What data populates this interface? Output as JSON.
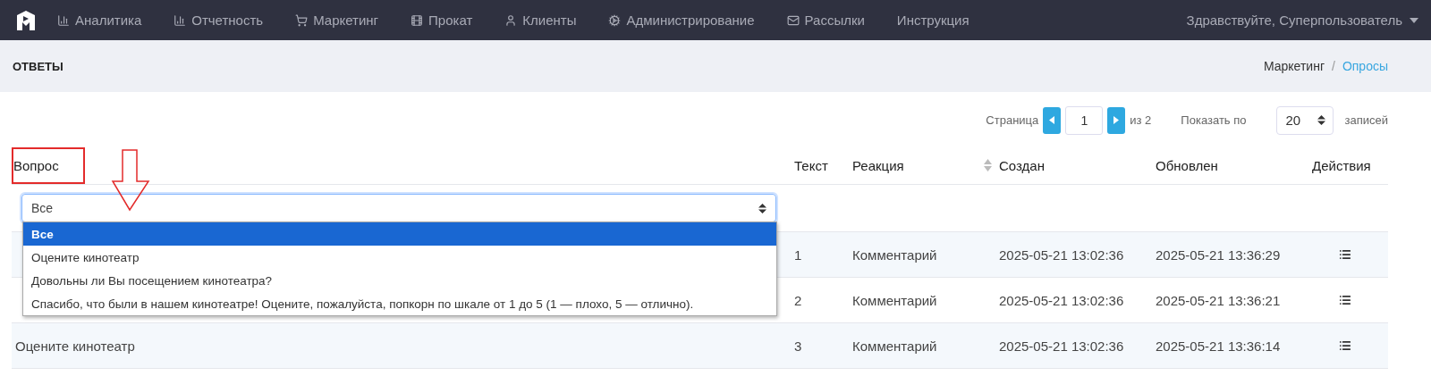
{
  "nav": {
    "items": [
      {
        "label": "Аналитика"
      },
      {
        "label": "Отчетность"
      },
      {
        "label": "Маркетинг"
      },
      {
        "label": "Прокат"
      },
      {
        "label": "Клиенты"
      },
      {
        "label": "Администрирование"
      },
      {
        "label": "Рассылки"
      },
      {
        "label": "Инструкция"
      }
    ],
    "user": "Здравствуйте, Суперпользователь"
  },
  "page_header": {
    "title": "ОТВЕТЫ",
    "separator": "/",
    "breadcrumb": [
      {
        "label": "Маркетинг",
        "kind": "text"
      },
      {
        "label": "Опросы",
        "kind": "link"
      }
    ]
  },
  "pagination": {
    "label": "Страница",
    "page": "1",
    "of": "из 2",
    "show_label": "Показать по",
    "per_page": "20",
    "suffix": "записей"
  },
  "table": {
    "columns": [
      {
        "label": "Вопрос",
        "sortable": false
      },
      {
        "label": "Текст",
        "sortable": false
      },
      {
        "label": "Реакция",
        "sortable": true
      },
      {
        "label": "Создан",
        "sortable": false
      },
      {
        "label": "Обновлен",
        "sortable": false
      },
      {
        "label": "Действия",
        "sortable": false
      }
    ],
    "filter": {
      "value": "Все",
      "expanded": true,
      "options": [
        {
          "label": "Все",
          "selected": true
        },
        {
          "label": "Оцените кинотеатр",
          "selected": false
        },
        {
          "label": "Довольны ли Вы посещением кинотеатра?",
          "selected": false
        },
        {
          "label": "Спасибо, что были в нашем кинотеатре! Оцените, пожалуйста, попкорн по шкале от 1 до 5 (1 — плохо, 5 — отлично).",
          "selected": false
        }
      ]
    },
    "rows": [
      {
        "text": "1",
        "reaction": "Комментарий",
        "created": "2025-05-21 13:02:36",
        "updated": "2025-05-21 13:36:29"
      },
      {
        "text": "2",
        "reaction": "Комментарий",
        "created": "2025-05-21 13:02:36",
        "updated": "2025-05-21 13:36:21"
      },
      {
        "question": "Оцените кинотеатр",
        "text": "3",
        "reaction": "Комментарий",
        "created": "2025-05-21 13:02:36",
        "updated": "2025-05-21 13:36:14"
      }
    ]
  },
  "annotations": {
    "box": true,
    "arrow": true
  }
}
